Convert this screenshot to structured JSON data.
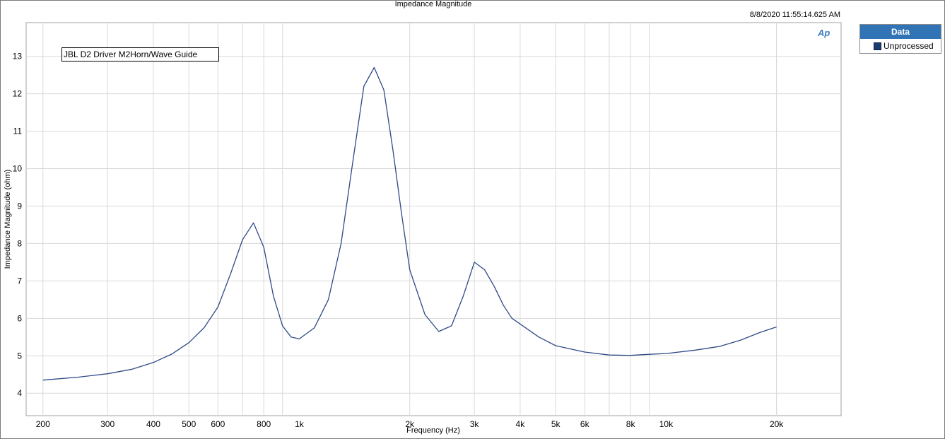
{
  "chart_data": {
    "type": "line",
    "title": "Impedance Magnitude",
    "timestamp": "8/8/2020 11:55:14.625 AM",
    "annotation": "JBL D2 Driver M2Horn/Wave Guide",
    "xlabel": "Frequency (Hz)",
    "ylabel": "Impedance Magnitude (ohm)",
    "x_scale": "log",
    "xlim": [
      180,
      30000
    ],
    "ylim": [
      3.4,
      13.9
    ],
    "grid": true,
    "x_ticks": [
      200,
      300,
      400,
      500,
      600,
      800,
      1000,
      2000,
      3000,
      4000,
      5000,
      6000,
      8000,
      10000,
      20000
    ],
    "x_tick_labels": [
      "200",
      "300",
      "400",
      "500",
      "600",
      "800",
      "1k",
      "2k",
      "3k",
      "4k",
      "5k",
      "6k",
      "8k",
      "10k",
      "20k"
    ],
    "y_ticks": [
      4,
      5,
      6,
      7,
      8,
      9,
      10,
      11,
      12,
      13
    ],
    "y_tick_labels": [
      "4",
      "5",
      "6",
      "7",
      "8",
      "9",
      "10",
      "11",
      "12",
      "13"
    ],
    "legend": {
      "title": "Data",
      "placement": "right"
    },
    "series": [
      {
        "name": "Unprocessed",
        "color": "#2e4a86",
        "x": [
          200,
          250,
          300,
          350,
          400,
          450,
          500,
          550,
          600,
          650,
          700,
          750,
          800,
          850,
          900,
          950,
          1000,
          1100,
          1200,
          1300,
          1400,
          1500,
          1600,
          1700,
          1800,
          1900,
          2000,
          2200,
          2400,
          2600,
          2800,
          3000,
          3200,
          3400,
          3600,
          3800,
          4000,
          4500,
          5000,
          5500,
          6000,
          7000,
          8000,
          9000,
          10000,
          12000,
          14000,
          16000,
          18000,
          20000
        ],
        "y": [
          4.35,
          4.43,
          4.52,
          4.64,
          4.82,
          5.05,
          5.35,
          5.75,
          6.3,
          7.2,
          8.1,
          8.55,
          7.9,
          6.6,
          5.8,
          5.5,
          5.45,
          5.75,
          6.5,
          8.0,
          10.2,
          12.2,
          12.7,
          12.1,
          10.5,
          8.8,
          7.3,
          6.1,
          5.65,
          5.8,
          6.6,
          7.5,
          7.3,
          6.85,
          6.35,
          6.0,
          5.85,
          5.5,
          5.27,
          5.18,
          5.1,
          5.02,
          5.01,
          5.04,
          5.06,
          5.15,
          5.25,
          5.42,
          5.62,
          5.77
        ]
      }
    ]
  }
}
